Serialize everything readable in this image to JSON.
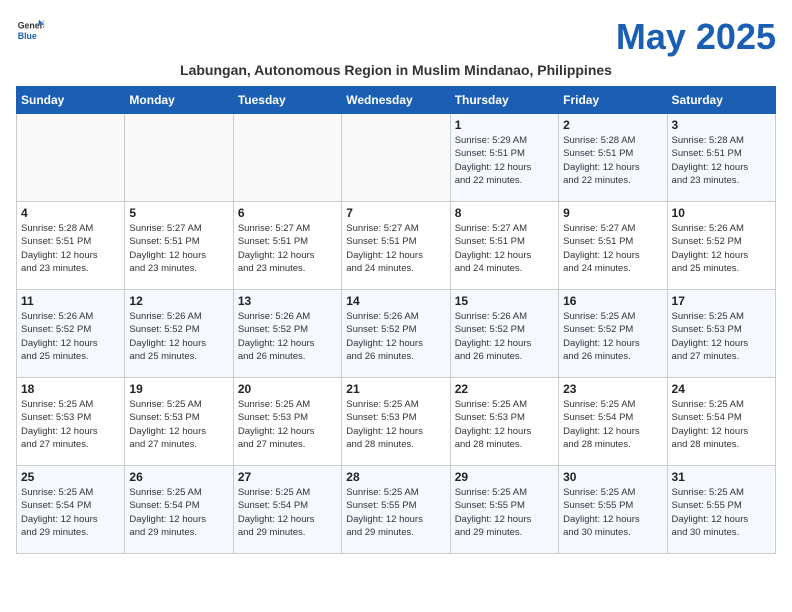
{
  "header": {
    "logo_general": "General",
    "logo_blue": "Blue",
    "month_title": "May 2025",
    "subtitle": "Labungan, Autonomous Region in Muslim Mindanao, Philippines"
  },
  "columns": [
    "Sunday",
    "Monday",
    "Tuesday",
    "Wednesday",
    "Thursday",
    "Friday",
    "Saturday"
  ],
  "weeks": [
    [
      {
        "day": "",
        "info": ""
      },
      {
        "day": "",
        "info": ""
      },
      {
        "day": "",
        "info": ""
      },
      {
        "day": "",
        "info": ""
      },
      {
        "day": "1",
        "info": "Sunrise: 5:29 AM\nSunset: 5:51 PM\nDaylight: 12 hours\nand 22 minutes."
      },
      {
        "day": "2",
        "info": "Sunrise: 5:28 AM\nSunset: 5:51 PM\nDaylight: 12 hours\nand 22 minutes."
      },
      {
        "day": "3",
        "info": "Sunrise: 5:28 AM\nSunset: 5:51 PM\nDaylight: 12 hours\nand 23 minutes."
      }
    ],
    [
      {
        "day": "4",
        "info": "Sunrise: 5:28 AM\nSunset: 5:51 PM\nDaylight: 12 hours\nand 23 minutes."
      },
      {
        "day": "5",
        "info": "Sunrise: 5:27 AM\nSunset: 5:51 PM\nDaylight: 12 hours\nand 23 minutes."
      },
      {
        "day": "6",
        "info": "Sunrise: 5:27 AM\nSunset: 5:51 PM\nDaylight: 12 hours\nand 23 minutes."
      },
      {
        "day": "7",
        "info": "Sunrise: 5:27 AM\nSunset: 5:51 PM\nDaylight: 12 hours\nand 24 minutes."
      },
      {
        "day": "8",
        "info": "Sunrise: 5:27 AM\nSunset: 5:51 PM\nDaylight: 12 hours\nand 24 minutes."
      },
      {
        "day": "9",
        "info": "Sunrise: 5:27 AM\nSunset: 5:51 PM\nDaylight: 12 hours\nand 24 minutes."
      },
      {
        "day": "10",
        "info": "Sunrise: 5:26 AM\nSunset: 5:52 PM\nDaylight: 12 hours\nand 25 minutes."
      }
    ],
    [
      {
        "day": "11",
        "info": "Sunrise: 5:26 AM\nSunset: 5:52 PM\nDaylight: 12 hours\nand 25 minutes."
      },
      {
        "day": "12",
        "info": "Sunrise: 5:26 AM\nSunset: 5:52 PM\nDaylight: 12 hours\nand 25 minutes."
      },
      {
        "day": "13",
        "info": "Sunrise: 5:26 AM\nSunset: 5:52 PM\nDaylight: 12 hours\nand 26 minutes."
      },
      {
        "day": "14",
        "info": "Sunrise: 5:26 AM\nSunset: 5:52 PM\nDaylight: 12 hours\nand 26 minutes."
      },
      {
        "day": "15",
        "info": "Sunrise: 5:26 AM\nSunset: 5:52 PM\nDaylight: 12 hours\nand 26 minutes."
      },
      {
        "day": "16",
        "info": "Sunrise: 5:25 AM\nSunset: 5:52 PM\nDaylight: 12 hours\nand 26 minutes."
      },
      {
        "day": "17",
        "info": "Sunrise: 5:25 AM\nSunset: 5:53 PM\nDaylight: 12 hours\nand 27 minutes."
      }
    ],
    [
      {
        "day": "18",
        "info": "Sunrise: 5:25 AM\nSunset: 5:53 PM\nDaylight: 12 hours\nand 27 minutes."
      },
      {
        "day": "19",
        "info": "Sunrise: 5:25 AM\nSunset: 5:53 PM\nDaylight: 12 hours\nand 27 minutes."
      },
      {
        "day": "20",
        "info": "Sunrise: 5:25 AM\nSunset: 5:53 PM\nDaylight: 12 hours\nand 27 minutes."
      },
      {
        "day": "21",
        "info": "Sunrise: 5:25 AM\nSunset: 5:53 PM\nDaylight: 12 hours\nand 28 minutes."
      },
      {
        "day": "22",
        "info": "Sunrise: 5:25 AM\nSunset: 5:53 PM\nDaylight: 12 hours\nand 28 minutes."
      },
      {
        "day": "23",
        "info": "Sunrise: 5:25 AM\nSunset: 5:54 PM\nDaylight: 12 hours\nand 28 minutes."
      },
      {
        "day": "24",
        "info": "Sunrise: 5:25 AM\nSunset: 5:54 PM\nDaylight: 12 hours\nand 28 minutes."
      }
    ],
    [
      {
        "day": "25",
        "info": "Sunrise: 5:25 AM\nSunset: 5:54 PM\nDaylight: 12 hours\nand 29 minutes."
      },
      {
        "day": "26",
        "info": "Sunrise: 5:25 AM\nSunset: 5:54 PM\nDaylight: 12 hours\nand 29 minutes."
      },
      {
        "day": "27",
        "info": "Sunrise: 5:25 AM\nSunset: 5:54 PM\nDaylight: 12 hours\nand 29 minutes."
      },
      {
        "day": "28",
        "info": "Sunrise: 5:25 AM\nSunset: 5:55 PM\nDaylight: 12 hours\nand 29 minutes."
      },
      {
        "day": "29",
        "info": "Sunrise: 5:25 AM\nSunset: 5:55 PM\nDaylight: 12 hours\nand 29 minutes."
      },
      {
        "day": "30",
        "info": "Sunrise: 5:25 AM\nSunset: 5:55 PM\nDaylight: 12 hours\nand 30 minutes."
      },
      {
        "day": "31",
        "info": "Sunrise: 5:25 AM\nSunset: 5:55 PM\nDaylight: 12 hours\nand 30 minutes."
      }
    ]
  ]
}
